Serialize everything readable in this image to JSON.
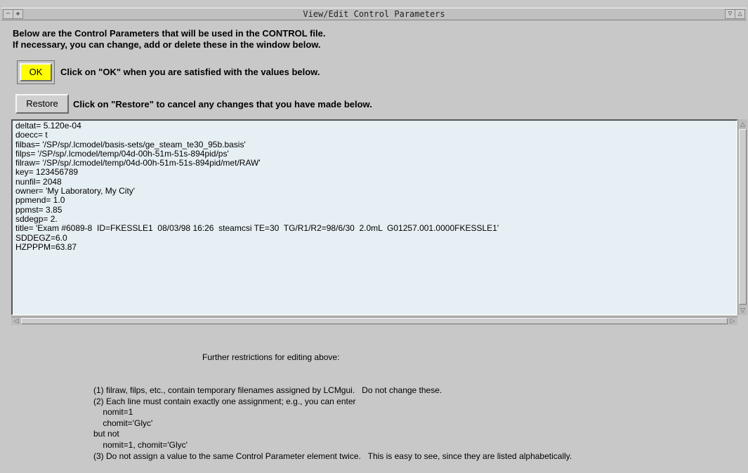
{
  "window": {
    "title": "View/Edit Control Parameters"
  },
  "intro": {
    "line1": "Below are the Control Parameters that will be used in the CONTROL file.",
    "line2": "If necessary, you can change, add or delete these in the window below."
  },
  "ok": {
    "label": "OK",
    "hint": "Click on \"OK\" when you are satisfied with the values below.",
    "color": "#ffff00"
  },
  "restore": {
    "label": "Restore",
    "hint": "Click on \"Restore\" to cancel any changes that you have made below."
  },
  "editor": {
    "lines": [
      "deltat= 5.120e-04",
      "doecc= t",
      "filbas= '/SP/sp/.lcmodel/basis-sets/ge_steam_te30_95b.basis'",
      "filps= '/SP/sp/.lcmodel/temp/04d-00h-51m-51s-894pid/ps'",
      "filraw= '/SP/sp/.lcmodel/temp/04d-00h-51m-51s-894pid/met/RAW'",
      "key= 123456789",
      "nunfil= 2048",
      "owner= 'My Laboratory, My City'",
      "ppmend= 1.0",
      "ppmst= 3.85",
      "sddegp= 2.",
      "title= 'Exam #6089-8  ID=FKESSLE1  08/03/98 16:26  steamcsi TE=30  TG/R1/R2=98/6/30  2.0mL  G01257.001.0000FKESSLE1'",
      "SDDEGZ=6.0",
      "HZPPPM=63.87"
    ]
  },
  "restrictions": {
    "heading": "Further restrictions for editing above:",
    "lines": [
      "(1) filraw, filps, etc., contain temporary filenames assigned by LCMgui.   Do not change these.",
      "(2) Each line must contain exactly one assignment; e.g., you can enter",
      "    nomit=1",
      "    chomit='Glyc'",
      "but not",
      "    nomit=1, chomit='Glyc'",
      "(3) Do not assign a value to the same Control Parameter element twice.   This is easy to see, since they are listed alphabetically."
    ]
  }
}
